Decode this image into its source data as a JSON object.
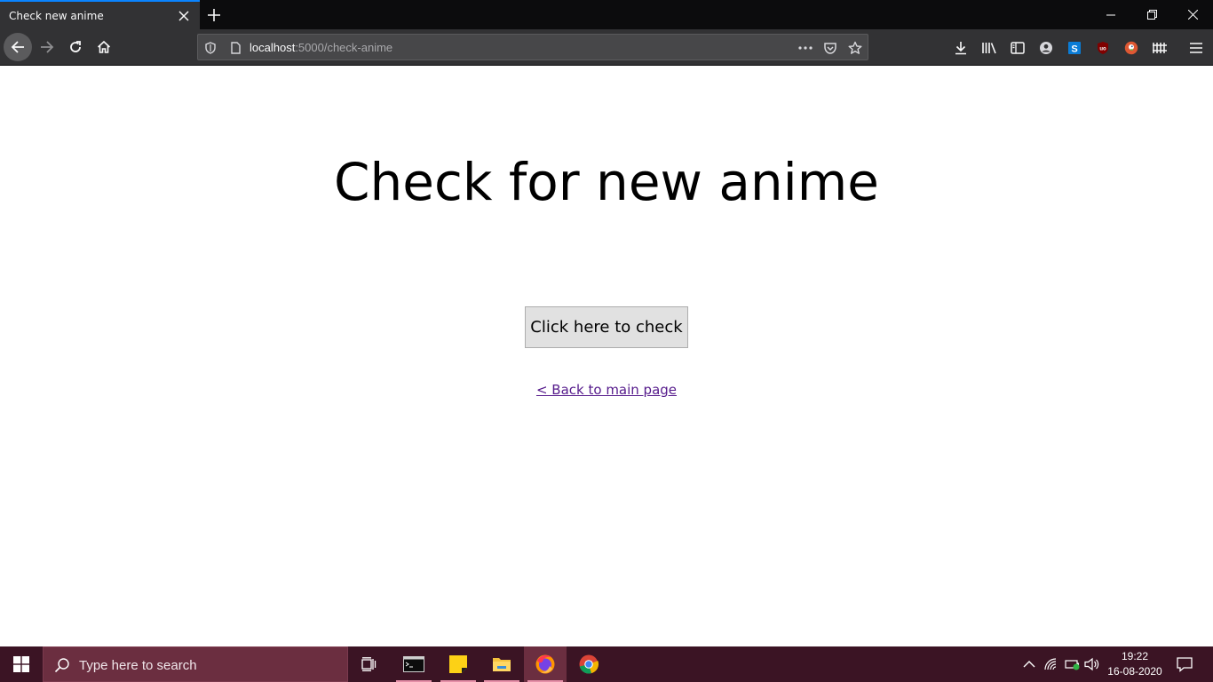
{
  "browser": {
    "tab_title": "Check new anime",
    "url_host": "localhost",
    "url_path": ":5000/check-anime"
  },
  "page": {
    "title": "Check for new anime",
    "check_button_label": "Click here to check",
    "back_link_label": "< Back to main page"
  },
  "taskbar": {
    "search_placeholder": "Type here to search",
    "time": "19:22",
    "date": "16-08-2020"
  },
  "colors": {
    "tab_accent": "#0a84ff",
    "taskbar_bg": "#3b1424",
    "visited_link": "#551a8b",
    "button_bg": "#e1e1e1"
  },
  "icons": [
    "close-icon",
    "plus-icon",
    "minimize-icon",
    "restore-icon",
    "back-arrow-icon",
    "forward-arrow-icon",
    "reload-icon",
    "home-icon",
    "shield-icon",
    "page-icon",
    "more-dots-icon",
    "pocket-icon",
    "star-icon",
    "download-icon",
    "library-icon",
    "sidebar-icon",
    "account-icon",
    "skype-icon",
    "ublock-icon",
    "duckduckgo-icon",
    "extension-icon",
    "menu-icon",
    "windows-icon",
    "search-icon",
    "task-view-icon",
    "terminal-icon",
    "sticky-notes-icon",
    "file-explorer-icon",
    "firefox-icon",
    "chrome-icon",
    "chevron-up-icon",
    "network-icon",
    "battery-icon",
    "volume-icon",
    "notification-icon"
  ]
}
